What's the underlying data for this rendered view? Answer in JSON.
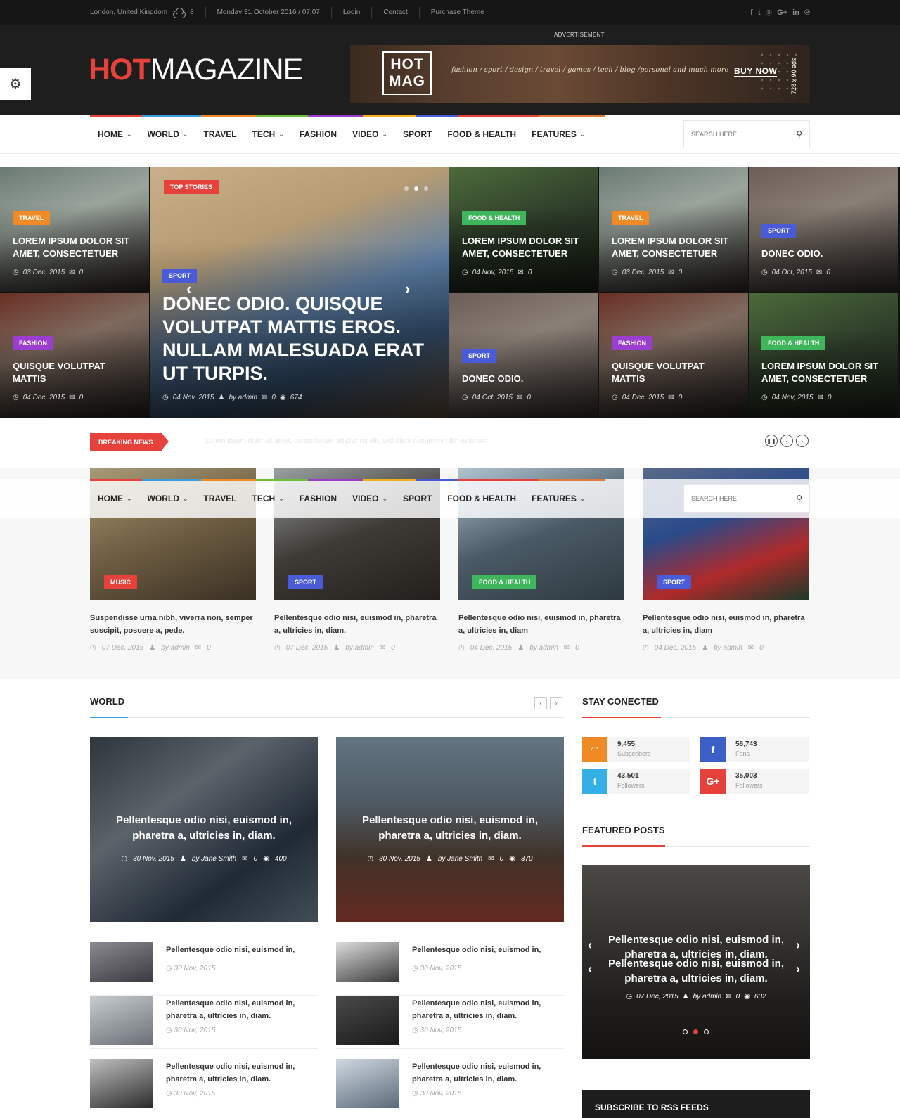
{
  "topbar": {
    "location": "London, United Kingdom",
    "temperature": "8",
    "datetime": "Monday 31 October 2016 / 07:07",
    "links": [
      "Login",
      "Contact",
      "Purchase Theme"
    ],
    "social_icons": [
      "facebook-icon",
      "twitter-icon",
      "instagram-icon",
      "googleplus-icon",
      "linkedin-icon",
      "pinterest-icon"
    ],
    "social_glyphs": [
      "f",
      "t",
      "◎",
      "G+",
      "in",
      "℗"
    ]
  },
  "header": {
    "logo_hot": "HOT",
    "logo_magazine": "MAGAZINE",
    "ad_label": "ADVERTISEMENT",
    "banner": {
      "box_line1": "HOT",
      "box_line2": "MAG",
      "tagline": "fashion / sport / design / travel / games / tech / blog /personal and much more",
      "buy_now": "BUY NOW",
      "size": "728 x 90 ads"
    }
  },
  "nav": {
    "items": [
      {
        "label": "HOME",
        "dropdown": true
      },
      {
        "label": "WORLD",
        "dropdown": true
      },
      {
        "label": "TRAVEL",
        "dropdown": false
      },
      {
        "label": "TECH",
        "dropdown": true
      },
      {
        "label": "FASHION",
        "dropdown": false
      },
      {
        "label": "VIDEO",
        "dropdown": true
      },
      {
        "label": "SPORT",
        "dropdown": false
      },
      {
        "label": "FOOD & HEALTH",
        "dropdown": false
      },
      {
        "label": "FEATURES",
        "dropdown": true
      }
    ],
    "bar_colors": [
      "#e7413b",
      "#3a9de0",
      "#f08a24",
      "#6bbf3a",
      "#9b3ed0",
      "#f2b01e",
      "#4a5bd8",
      "#e7413b",
      "#e07a3a"
    ],
    "search_placeholder": "SEARCH HERE"
  },
  "colors": {
    "accent": "#e7413b",
    "travel": "#f08a24",
    "fashion": "#9b3ed0",
    "food_health": "#3fb65b",
    "sport": "#4a5bd8",
    "music": "#e7413b"
  },
  "hero": {
    "main": {
      "badge": "TOP STORIES",
      "category": "SPORT",
      "title": "DONEC ODIO. QUISQUE VOLUTPAT MATTIS EROS. NULLAM MALESUADA ERAT UT TURPIS.",
      "date": "04 Nov, 2015",
      "author": "by admin",
      "comments": "0",
      "views": "674"
    },
    "tiles": [
      {
        "category": "TRAVEL",
        "title": "LOREM IPSUM DOLOR SIT AMET, CONSECTETUER",
        "date": "03 Dec, 2015",
        "comments": "0"
      },
      {
        "category": "FASHION",
        "title": "QUISQUE VOLUTPAT MATTIS",
        "date": "04 Dec, 2015",
        "comments": "0"
      },
      {
        "category": "FOOD & HEALTH",
        "title": "LOREM IPSUM DOLOR SIT AMET, CONSECTETUER",
        "date": "04 Nov, 2015",
        "comments": "0"
      },
      {
        "category": "SPORT",
        "title": "DONEC ODIO.",
        "date": "04 Oct, 2015",
        "comments": "0"
      },
      {
        "category": "TRAVEL",
        "title": "LOREM IPSUM DOLOR SIT AMET, CONSECTETUER",
        "date": "03 Dec, 2015",
        "comments": "0"
      },
      {
        "category": "FASHION",
        "title": "QUISQUE VOLUTPAT MATTIS",
        "date": "04 Dec, 2015",
        "comments": "0"
      },
      {
        "category": "SPORT",
        "title": "DONEC ODIO.",
        "date": "04 Oct, 2015",
        "comments": "0"
      },
      {
        "category": "FOOD & HEALTH",
        "title": "LOREM IPSUM DOLOR SIT AMET, CONSECTETUER",
        "date": "04 Nov, 2015",
        "comments": "0"
      }
    ]
  },
  "breaking": {
    "label": "BREAKING NEWS",
    "ticker": "Lorem ipsum dolor sit amet, consectetuer adipiscing elit, sed diam nonummy nibh euismod"
  },
  "posts": [
    {
      "category": "MUSIC",
      "title": "Suspendisse urna nibh, viverra non, semper suscipit, posuere a, pede.",
      "date": "07 Dec, 2015",
      "author": "by admin",
      "comments": "0"
    },
    {
      "category": "SPORT",
      "title": "Pellentesque odio nisi, euismod in, pharetra a, ultricies in, diam.",
      "date": "07 Dec, 2015",
      "author": "by admin",
      "comments": "0"
    },
    {
      "category": "FOOD & HEALTH",
      "title": "Pellentesque odio nisi, euismod in, pharetra a, ultricies in, diam",
      "date": "04 Dec, 2015",
      "author": "by admin",
      "comments": "0"
    },
    {
      "category": "SPORT",
      "title": "Pellentesque odio nisi, euismod in, pharetra a, ultricies in, diam",
      "date": "04 Dec, 2015",
      "author": "by admin",
      "comments": "0"
    }
  ],
  "world": {
    "title": "WORLD",
    "big": [
      {
        "title": "Pellentesque odio nisi, euismod in, pharetra a, ultricies in, diam.",
        "date": "30 Nov, 2015",
        "author": "by Jane Smith",
        "comments": "0",
        "views": "400"
      },
      {
        "title": "Pellentesque odio nisi, euismod in, pharetra a, ultricies in, diam.",
        "date": "30 Nov, 2015",
        "author": "by Jane Smith",
        "comments": "0",
        "views": "370"
      }
    ],
    "small_left": [
      {
        "title": "Pellentesque odio nisi, euismod in,",
        "date": "30 Nov, 2015"
      },
      {
        "title": "Pellentesque odio nisi, euismod in, pharetra a, ultricies in, diam.",
        "date": "30 Nov, 2015"
      },
      {
        "title": "Pellentesque odio nisi, euismod in, pharetra a, ultricies in, diam.",
        "date": "30 Nov, 2015"
      }
    ],
    "small_right": [
      {
        "title": "Pellentesque odio nisi, euismod in,",
        "date": "30 Nov, 2015"
      },
      {
        "title": "Pellentesque odio nisi, euismod in, pharetra a, ultricies in, diam.",
        "date": "30 Nov, 2015"
      },
      {
        "title": "Pellentesque odio nisi, euismod in, pharetra a, ultricies in, diam.",
        "date": "30 Nov, 2015"
      }
    ]
  },
  "stay": {
    "title": "STAY CONECTED",
    "cards": [
      {
        "icon": "rss-icon",
        "glyph": "◠",
        "color": "#f08a24",
        "count": "9,455",
        "label": "Subscribers"
      },
      {
        "icon": "facebook-icon",
        "glyph": "f",
        "color": "#3b5fc7",
        "count": "56,743",
        "label": "Fans"
      },
      {
        "icon": "twitter-icon",
        "glyph": "t",
        "color": "#35b0e6",
        "count": "43,501",
        "label": "Followers"
      },
      {
        "icon": "googleplus-icon",
        "glyph": "G+",
        "color": "#e7413b",
        "count": "35,003",
        "label": "Followers"
      }
    ]
  },
  "featured": {
    "title": "FEATURED POSTS",
    "slide_title": "Pellentesque odio nisi, euismod in, pharetra a, ultricies in, diam.",
    "date": "07 Dec, 2015",
    "author": "by admin",
    "comments": "0",
    "views": "632"
  },
  "rss": {
    "title": "SUBSCRIBE TO RSS FEEDS"
  }
}
